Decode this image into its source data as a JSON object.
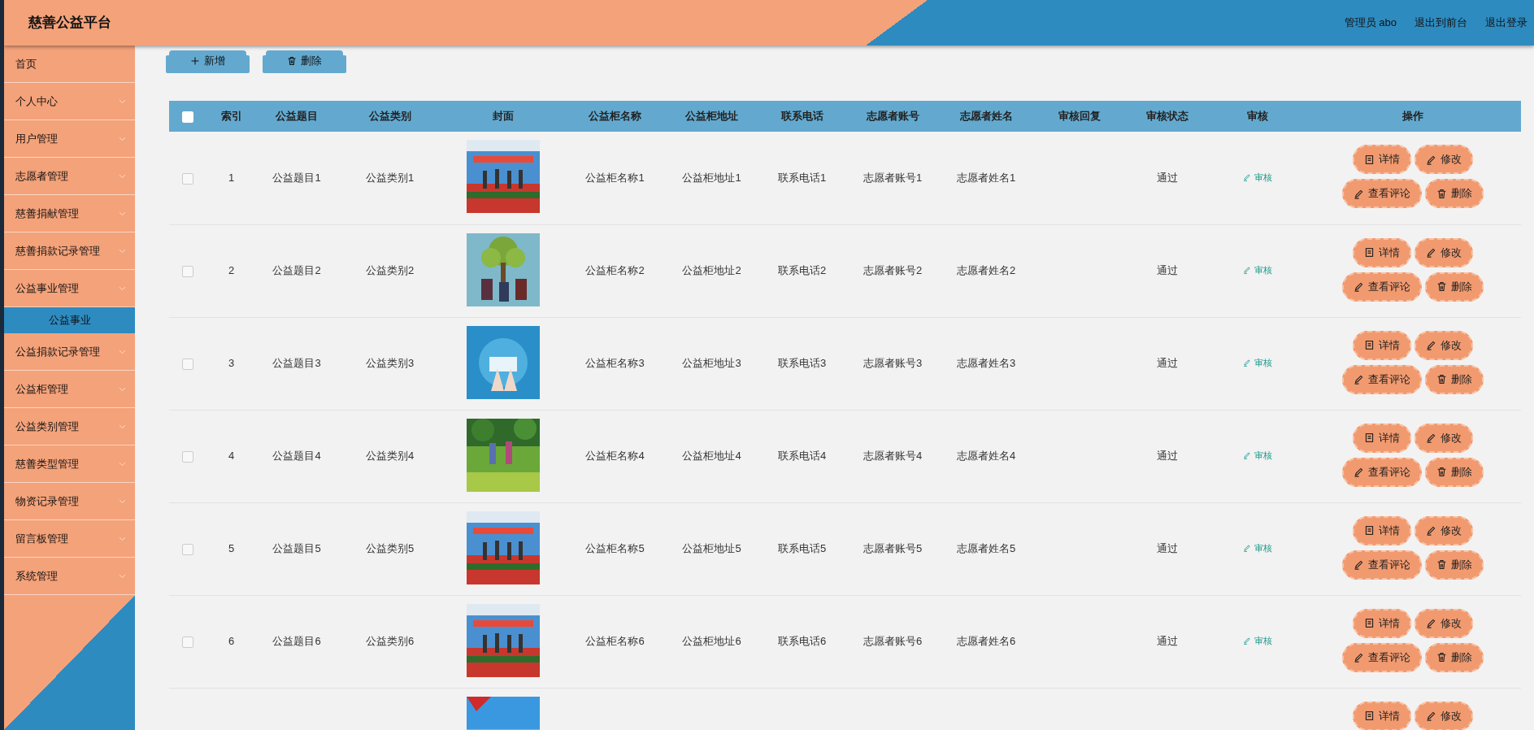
{
  "header": {
    "title": "慈善公益平台",
    "links": [
      {
        "label": "管理员 abo"
      },
      {
        "label": "退出到前台"
      },
      {
        "label": "退出登录"
      }
    ]
  },
  "sidebar": {
    "items": [
      {
        "label": "首页",
        "kind": "link"
      },
      {
        "label": "个人中心",
        "kind": "menu"
      },
      {
        "label": "用户管理",
        "kind": "menu"
      },
      {
        "label": "志愿者管理",
        "kind": "menu"
      },
      {
        "label": "慈善捐献管理",
        "kind": "menu"
      },
      {
        "label": "慈善捐款记录管理",
        "kind": "menu"
      },
      {
        "label": "公益事业管理",
        "kind": "menu",
        "children": [
          {
            "label": "公益事业",
            "selected": true
          }
        ]
      },
      {
        "label": "公益捐款记录管理",
        "kind": "menu"
      },
      {
        "label": "公益柜管理",
        "kind": "menu"
      },
      {
        "label": "公益类别管理",
        "kind": "menu"
      },
      {
        "label": "慈善类型管理",
        "kind": "menu"
      },
      {
        "label": "物资记录管理",
        "kind": "menu"
      },
      {
        "label": "留言板管理",
        "kind": "menu"
      },
      {
        "label": "系统管理",
        "kind": "menu"
      }
    ]
  },
  "toolbar": {
    "buttons": [
      {
        "label": "新增",
        "kind": "add"
      },
      {
        "label": "删除",
        "kind": "delete"
      }
    ]
  },
  "table": {
    "select_all": {
      "checked": false
    },
    "columns": [
      "索引",
      "公益题目",
      "公益类别",
      "封面",
      "公益柜名称",
      "公益柜地址",
      "联系电话",
      "志愿者账号",
      "志愿者姓名",
      "审核回复",
      "审核状态",
      "审核",
      "操作"
    ],
    "rows": [
      {
        "checked": false,
        "index": "1",
        "title": "公益题目1",
        "category": "公益类别1",
        "cover": {
          "kind": "picture"
        },
        "cabinet_name": "公益柜名称1",
        "cabinet_address": "公益柜地址1",
        "phone": "联系电话1",
        "volunteer_account": "志愿者账号1",
        "volunteer_name": "志愿者姓名1",
        "status": "通过",
        "review_link": "审核",
        "actions": [
          {
            "label": "详情",
            "kind": "detail"
          },
          {
            "label": "修改",
            "kind": "edit"
          },
          {
            "label": "查看评论",
            "kind": "comments"
          },
          {
            "label": "删除",
            "kind": "delete"
          }
        ]
      },
      {
        "checked": false,
        "index": "2",
        "title": "公益题目2",
        "category": "公益类别2",
        "cover": {
          "kind": "picture"
        },
        "cabinet_name": "公益柜名称2",
        "cabinet_address": "公益柜地址2",
        "phone": "联系电话2",
        "volunteer_account": "志愿者账号2",
        "volunteer_name": "志愿者姓名2",
        "status": "通过",
        "review_link": "审核",
        "actions": [
          {
            "label": "详情",
            "kind": "detail"
          },
          {
            "label": "修改",
            "kind": "edit"
          },
          {
            "label": "查看评论",
            "kind": "comments"
          },
          {
            "label": "删除",
            "kind": "delete"
          }
        ]
      },
      {
        "checked": false,
        "index": "3",
        "title": "公益题目3",
        "category": "公益类别3",
        "cover": {
          "kind": "picture"
        },
        "cabinet_name": "公益柜名称3",
        "cabinet_address": "公益柜地址3",
        "phone": "联系电话3",
        "volunteer_account": "志愿者账号3",
        "volunteer_name": "志愿者姓名3",
        "status": "通过",
        "review_link": "审核",
        "actions": [
          {
            "label": "详情",
            "kind": "detail"
          },
          {
            "label": "修改",
            "kind": "edit"
          },
          {
            "label": "查看评论",
            "kind": "comments"
          },
          {
            "label": "删除",
            "kind": "delete"
          }
        ]
      },
      {
        "checked": false,
        "index": "4",
        "title": "公益题目4",
        "category": "公益类别4",
        "cover": {
          "kind": "picture"
        },
        "cabinet_name": "公益柜名称4",
        "cabinet_address": "公益柜地址4",
        "phone": "联系电话4",
        "volunteer_account": "志愿者账号4",
        "volunteer_name": "志愿者姓名4",
        "status": "通过",
        "review_link": "审核",
        "actions": [
          {
            "label": "详情",
            "kind": "detail"
          },
          {
            "label": "修改",
            "kind": "edit"
          },
          {
            "label": "查看评论",
            "kind": "comments"
          },
          {
            "label": "删除",
            "kind": "delete"
          }
        ]
      },
      {
        "checked": false,
        "index": "5",
        "title": "公益题目5",
        "category": "公益类别5",
        "cover": {
          "kind": "picture"
        },
        "cabinet_name": "公益柜名称5",
        "cabinet_address": "公益柜地址5",
        "phone": "联系电话5",
        "volunteer_account": "志愿者账号5",
        "volunteer_name": "志愿者姓名5",
        "status": "通过",
        "review_link": "审核",
        "actions": [
          {
            "label": "详情",
            "kind": "detail"
          },
          {
            "label": "修改",
            "kind": "edit"
          },
          {
            "label": "查看评论",
            "kind": "comments"
          },
          {
            "label": "删除",
            "kind": "delete"
          }
        ]
      },
      {
        "checked": false,
        "index": "6",
        "title": "公益题目6",
        "category": "公益类别6",
        "cover": {
          "kind": "picture"
        },
        "cabinet_name": "公益柜名称6",
        "cabinet_address": "公益柜地址6",
        "phone": "联系电话6",
        "volunteer_account": "志愿者账号6",
        "volunteer_name": "志愿者姓名6",
        "status": "通过",
        "review_link": "审核",
        "actions": [
          {
            "label": "详情",
            "kind": "detail"
          },
          {
            "label": "修改",
            "kind": "edit"
          },
          {
            "label": "查看评论",
            "kind": "comments"
          },
          {
            "label": "删除",
            "kind": "delete"
          }
        ]
      },
      {
        "cover": {
          "kind": "picture"
        },
        "actions": [
          {
            "label": "详情",
            "kind": "detail"
          },
          {
            "label": "修改",
            "kind": "edit"
          }
        ]
      }
    ]
  }
}
